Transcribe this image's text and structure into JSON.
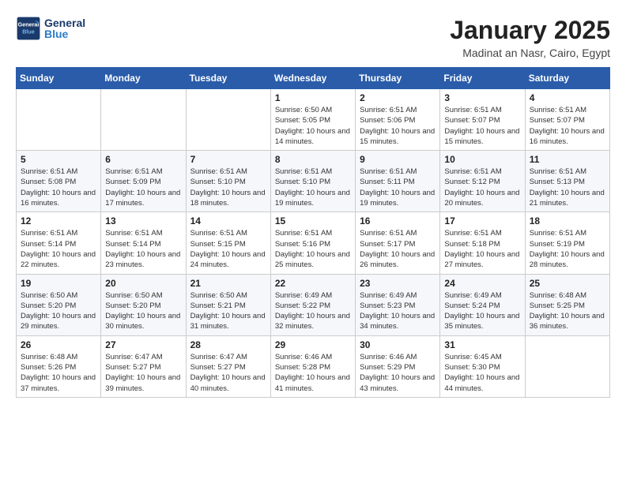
{
  "logo": {
    "line1": "General",
    "line2": "Blue"
  },
  "title": "January 2025",
  "subtitle": "Madinat an Nasr, Cairo, Egypt",
  "weekdays": [
    "Sunday",
    "Monday",
    "Tuesday",
    "Wednesday",
    "Thursday",
    "Friday",
    "Saturday"
  ],
  "weeks": [
    [
      {
        "day": null
      },
      {
        "day": null
      },
      {
        "day": null
      },
      {
        "day": "1",
        "sunrise": "Sunrise: 6:50 AM",
        "sunset": "Sunset: 5:05 PM",
        "daylight": "Daylight: 10 hours and 14 minutes."
      },
      {
        "day": "2",
        "sunrise": "Sunrise: 6:51 AM",
        "sunset": "Sunset: 5:06 PM",
        "daylight": "Daylight: 10 hours and 15 minutes."
      },
      {
        "day": "3",
        "sunrise": "Sunrise: 6:51 AM",
        "sunset": "Sunset: 5:07 PM",
        "daylight": "Daylight: 10 hours and 15 minutes."
      },
      {
        "day": "4",
        "sunrise": "Sunrise: 6:51 AM",
        "sunset": "Sunset: 5:07 PM",
        "daylight": "Daylight: 10 hours and 16 minutes."
      }
    ],
    [
      {
        "day": "5",
        "sunrise": "Sunrise: 6:51 AM",
        "sunset": "Sunset: 5:08 PM",
        "daylight": "Daylight: 10 hours and 16 minutes."
      },
      {
        "day": "6",
        "sunrise": "Sunrise: 6:51 AM",
        "sunset": "Sunset: 5:09 PM",
        "daylight": "Daylight: 10 hours and 17 minutes."
      },
      {
        "day": "7",
        "sunrise": "Sunrise: 6:51 AM",
        "sunset": "Sunset: 5:10 PM",
        "daylight": "Daylight: 10 hours and 18 minutes."
      },
      {
        "day": "8",
        "sunrise": "Sunrise: 6:51 AM",
        "sunset": "Sunset: 5:10 PM",
        "daylight": "Daylight: 10 hours and 19 minutes."
      },
      {
        "day": "9",
        "sunrise": "Sunrise: 6:51 AM",
        "sunset": "Sunset: 5:11 PM",
        "daylight": "Daylight: 10 hours and 19 minutes."
      },
      {
        "day": "10",
        "sunrise": "Sunrise: 6:51 AM",
        "sunset": "Sunset: 5:12 PM",
        "daylight": "Daylight: 10 hours and 20 minutes."
      },
      {
        "day": "11",
        "sunrise": "Sunrise: 6:51 AM",
        "sunset": "Sunset: 5:13 PM",
        "daylight": "Daylight: 10 hours and 21 minutes."
      }
    ],
    [
      {
        "day": "12",
        "sunrise": "Sunrise: 6:51 AM",
        "sunset": "Sunset: 5:14 PM",
        "daylight": "Daylight: 10 hours and 22 minutes."
      },
      {
        "day": "13",
        "sunrise": "Sunrise: 6:51 AM",
        "sunset": "Sunset: 5:14 PM",
        "daylight": "Daylight: 10 hours and 23 minutes."
      },
      {
        "day": "14",
        "sunrise": "Sunrise: 6:51 AM",
        "sunset": "Sunset: 5:15 PM",
        "daylight": "Daylight: 10 hours and 24 minutes."
      },
      {
        "day": "15",
        "sunrise": "Sunrise: 6:51 AM",
        "sunset": "Sunset: 5:16 PM",
        "daylight": "Daylight: 10 hours and 25 minutes."
      },
      {
        "day": "16",
        "sunrise": "Sunrise: 6:51 AM",
        "sunset": "Sunset: 5:17 PM",
        "daylight": "Daylight: 10 hours and 26 minutes."
      },
      {
        "day": "17",
        "sunrise": "Sunrise: 6:51 AM",
        "sunset": "Sunset: 5:18 PM",
        "daylight": "Daylight: 10 hours and 27 minutes."
      },
      {
        "day": "18",
        "sunrise": "Sunrise: 6:51 AM",
        "sunset": "Sunset: 5:19 PM",
        "daylight": "Daylight: 10 hours and 28 minutes."
      }
    ],
    [
      {
        "day": "19",
        "sunrise": "Sunrise: 6:50 AM",
        "sunset": "Sunset: 5:20 PM",
        "daylight": "Daylight: 10 hours and 29 minutes."
      },
      {
        "day": "20",
        "sunrise": "Sunrise: 6:50 AM",
        "sunset": "Sunset: 5:20 PM",
        "daylight": "Daylight: 10 hours and 30 minutes."
      },
      {
        "day": "21",
        "sunrise": "Sunrise: 6:50 AM",
        "sunset": "Sunset: 5:21 PM",
        "daylight": "Daylight: 10 hours and 31 minutes."
      },
      {
        "day": "22",
        "sunrise": "Sunrise: 6:49 AM",
        "sunset": "Sunset: 5:22 PM",
        "daylight": "Daylight: 10 hours and 32 minutes."
      },
      {
        "day": "23",
        "sunrise": "Sunrise: 6:49 AM",
        "sunset": "Sunset: 5:23 PM",
        "daylight": "Daylight: 10 hours and 34 minutes."
      },
      {
        "day": "24",
        "sunrise": "Sunrise: 6:49 AM",
        "sunset": "Sunset: 5:24 PM",
        "daylight": "Daylight: 10 hours and 35 minutes."
      },
      {
        "day": "25",
        "sunrise": "Sunrise: 6:48 AM",
        "sunset": "Sunset: 5:25 PM",
        "daylight": "Daylight: 10 hours and 36 minutes."
      }
    ],
    [
      {
        "day": "26",
        "sunrise": "Sunrise: 6:48 AM",
        "sunset": "Sunset: 5:26 PM",
        "daylight": "Daylight: 10 hours and 37 minutes."
      },
      {
        "day": "27",
        "sunrise": "Sunrise: 6:47 AM",
        "sunset": "Sunset: 5:27 PM",
        "daylight": "Daylight: 10 hours and 39 minutes."
      },
      {
        "day": "28",
        "sunrise": "Sunrise: 6:47 AM",
        "sunset": "Sunset: 5:27 PM",
        "daylight": "Daylight: 10 hours and 40 minutes."
      },
      {
        "day": "29",
        "sunrise": "Sunrise: 6:46 AM",
        "sunset": "Sunset: 5:28 PM",
        "daylight": "Daylight: 10 hours and 41 minutes."
      },
      {
        "day": "30",
        "sunrise": "Sunrise: 6:46 AM",
        "sunset": "Sunset: 5:29 PM",
        "daylight": "Daylight: 10 hours and 43 minutes."
      },
      {
        "day": "31",
        "sunrise": "Sunrise: 6:45 AM",
        "sunset": "Sunset: 5:30 PM",
        "daylight": "Daylight: 10 hours and 44 minutes."
      },
      {
        "day": null
      }
    ]
  ]
}
